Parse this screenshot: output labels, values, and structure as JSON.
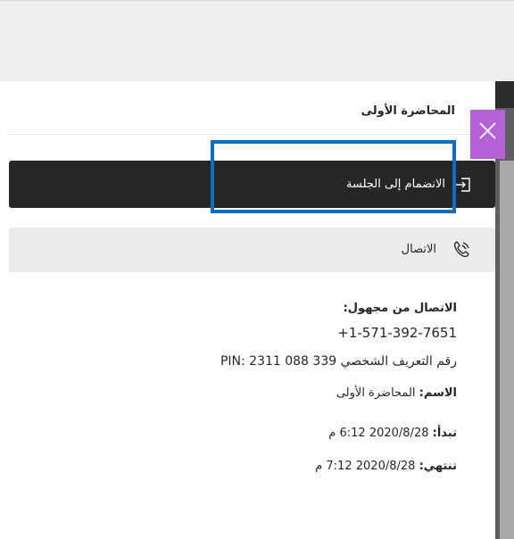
{
  "session": {
    "title": "المحاضرة الأولى"
  },
  "actions": {
    "join_label": "الانضمام إلى الجلسة",
    "call_label": "الاتصال"
  },
  "dial_in": {
    "heading": "الاتصال من مجهول:",
    "phone_number": "+1-571-392-7651",
    "pin_text": "رقم التعريف الشخصي PIN: 2311 088 339"
  },
  "details": {
    "name_label": "الاسم:",
    "name_value": "المحاضرة الأولى",
    "start_label": "تبدأ:",
    "start_value": "2020/8/28 6:12 م",
    "end_label": "تنتهي:",
    "end_value": "2020/8/28 7:12 م"
  },
  "icons": {
    "join": "enter-door-icon",
    "call": "phone-icon",
    "close": "close-icon"
  },
  "colors": {
    "join_button_bg": "#262626",
    "call_button_bg": "#ebebeb",
    "focus_ring": "#0a6ec6",
    "close_button_bg": "#b562d6"
  }
}
